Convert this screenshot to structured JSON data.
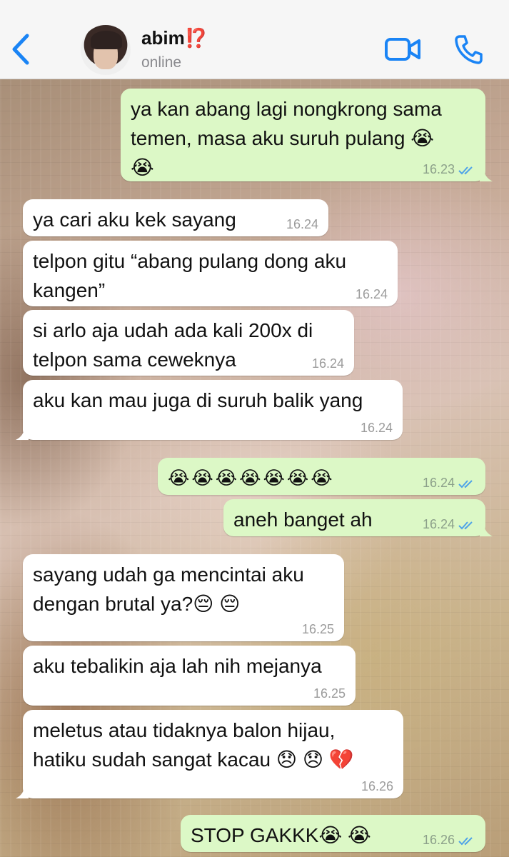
{
  "header": {
    "contact_name": "abim⁉️",
    "status": "online"
  },
  "icons": {
    "back": "chevron-left-icon",
    "video": "video-camera-icon",
    "call": "phone-icon",
    "read_receipt": "double-check-icon"
  },
  "colors": {
    "accent": "#1a84f5",
    "outgoing_bubble": "#dcf8c6",
    "incoming_bubble": "#ffffff",
    "read_tick": "#4fa3e8"
  },
  "messages": [
    {
      "dir": "out",
      "text": "ya kan abang lagi nongkrong sama temen, masa aku suruh pulang 😭\n😭",
      "time": "16.23"
    },
    {
      "dir": "in",
      "text": "ya cari aku kek sayang",
      "time": "16.24"
    },
    {
      "dir": "in",
      "text": "telpon gitu “abang pulang dong aku kangen”",
      "time": "16.24"
    },
    {
      "dir": "in",
      "text": "si arlo aja udah ada kali 200x di telpon sama ceweknya",
      "time": "16.24"
    },
    {
      "dir": "in",
      "text": "aku kan mau juga di suruh balik yang",
      "time": "16.24"
    },
    {
      "dir": "out",
      "text": "😭😭😭😭😭😭😭",
      "time": "16.24"
    },
    {
      "dir": "out",
      "text": "aneh banget ah",
      "time": "16.24"
    },
    {
      "dir": "in",
      "text": "sayang udah ga mencintai aku dengan brutal ya?😔 😔",
      "time": "16.25"
    },
    {
      "dir": "in",
      "text": "aku tebalikin aja lah nih mejanya",
      "time": "16.25"
    },
    {
      "dir": "in",
      "text": "meletus atau tidaknya balon hijau, hatiku sudah sangat kacau 😞 😞 💔",
      "time": "16.26"
    },
    {
      "dir": "out",
      "text": "STOP GAKKK😭 😭",
      "time": "16.26"
    }
  ]
}
